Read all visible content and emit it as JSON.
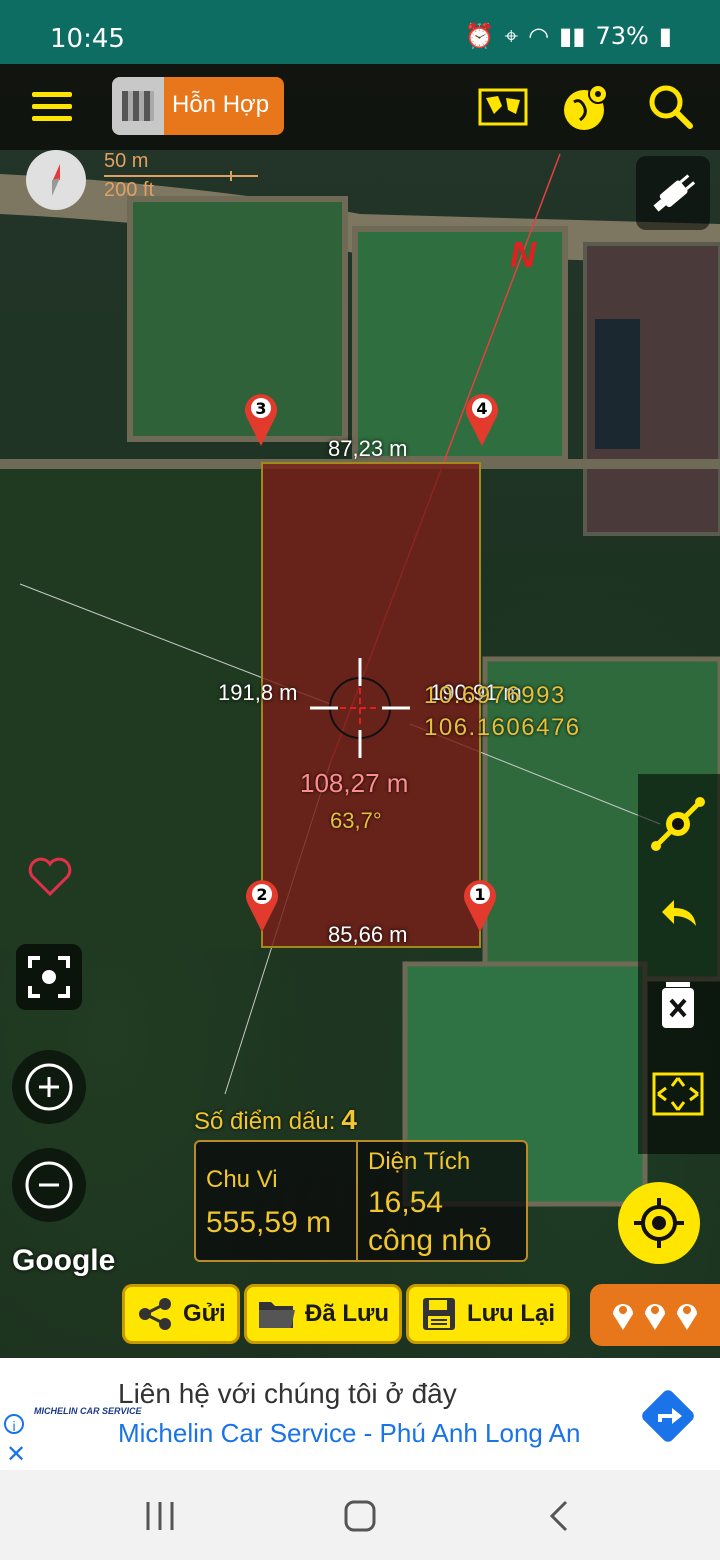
{
  "status_bar": {
    "time": "10:45",
    "battery": "73%"
  },
  "toolbar": {
    "map_type_label": "Hỗn Hợp"
  },
  "scale": {
    "metric": "50 m",
    "imperial": "200 ft"
  },
  "map": {
    "north_label": "N",
    "markers": [
      "3",
      "4",
      "2",
      "1"
    ],
    "edge_labels": {
      "top": "87,23 m",
      "bottom": "85,66 m",
      "left": "191,8 m",
      "right": "190,91 m"
    },
    "coordinates": {
      "lat": "10.6976993",
      "lon": "106.1606476"
    },
    "center_distance": "108,27 m",
    "center_angle": "63,7°",
    "google_logo": "Google"
  },
  "measurement": {
    "point_count_label": "Số điểm dấu:",
    "point_count": "4",
    "perimeter_label": "Chu Vi",
    "perimeter_value": "555,59 m",
    "area_label": "Diện Tích",
    "area_value": "16,54",
    "area_unit": "công nhỏ"
  },
  "bottom_bar": {
    "send": "Gửi",
    "saved": "Đã Lưu",
    "save": "Lưu Lại"
  },
  "ad": {
    "logo_text": "MICHELIN CAR SERVICE",
    "title": "Liên hệ với chúng tôi ở đây",
    "subtitle": "Michelin Car Service - Phú Anh Long An"
  },
  "colors": {
    "status_bar": "#0d6d62",
    "accent_yellow": "#ffe600",
    "accent_orange": "#e8761a",
    "polygon_fill": "#781e19",
    "marker_red": "#e23b2e"
  }
}
